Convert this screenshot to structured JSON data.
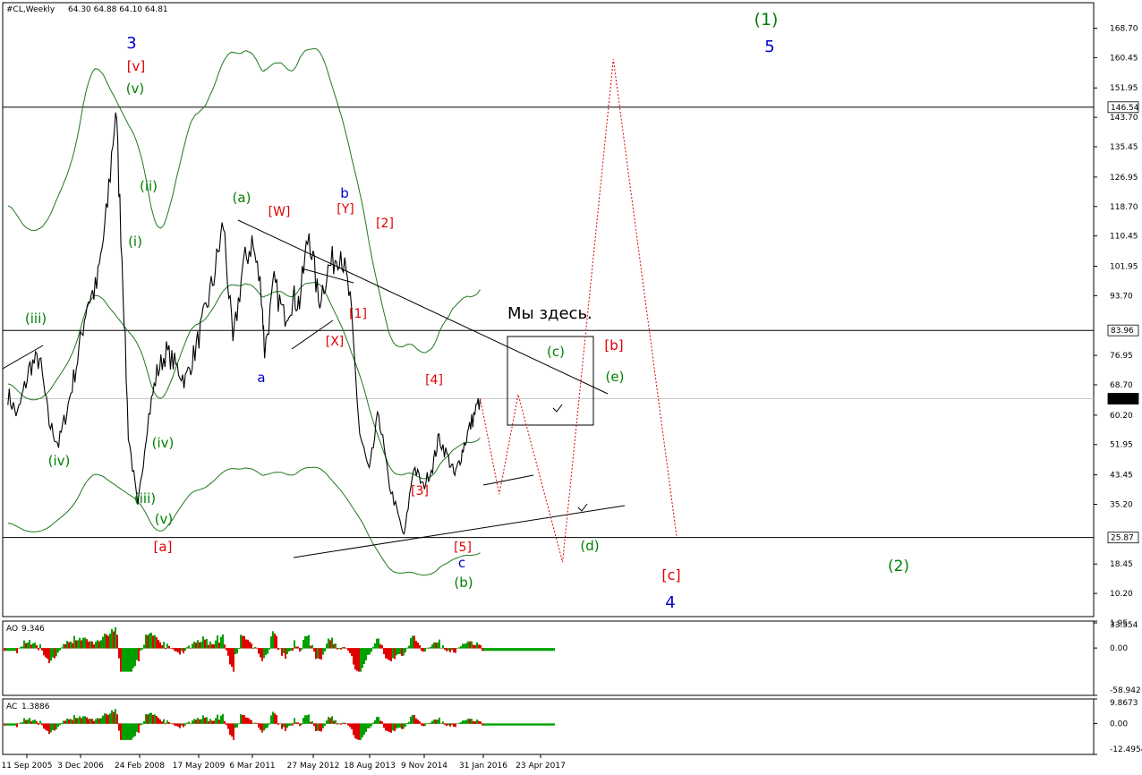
{
  "header": {
    "symbol": "#CL,Weekly",
    "ohlc": "64.30 64.88 64.10 64.81"
  },
  "chart_data": {
    "type": "line",
    "price_axis": {
      "ticks": [
        "168.70",
        "160.45",
        "151.95",
        "143.70",
        "135.45",
        "126.95",
        "118.70",
        "110.45",
        "101.95",
        "93.70",
        "76.95",
        "68.70",
        "60.20",
        "51.95",
        "43.45",
        "35.20",
        "18.45",
        "10.20",
        "1.95"
      ],
      "tick_values": [
        168.7,
        160.45,
        151.95,
        143.7,
        135.45,
        126.95,
        118.7,
        110.45,
        101.95,
        93.7,
        76.95,
        68.7,
        60.2,
        51.95,
        43.45,
        35.2,
        18.45,
        10.2,
        1.95
      ],
      "range": [
        1.95,
        168.7
      ]
    },
    "price_tags": [
      {
        "label": "146.54",
        "value": 146.54,
        "style": "line"
      },
      {
        "label": "83.96",
        "value": 83.96,
        "style": "line"
      },
      {
        "label": "64.81",
        "value": 64.81,
        "style": "current"
      },
      {
        "label": "25.87",
        "value": 25.87,
        "style": "line"
      }
    ],
    "time_axis": [
      "11 Sep 2005",
      "3 Dec 2006",
      "24 Feb 2008",
      "17 May 2009",
      "6 Mar 2011",
      "27 May 2012",
      "18 Aug 2013",
      "9 Nov 2014",
      "31 Jan 2016",
      "23 Apr 2017"
    ],
    "price_series": [
      [
        "2005-09",
        66
      ],
      [
        "2005-12",
        60
      ],
      [
        "2006-04",
        74
      ],
      [
        "2006-07",
        76
      ],
      [
        "2006-10",
        58
      ],
      [
        "2007-01",
        52
      ],
      [
        "2007-04",
        63
      ],
      [
        "2007-07",
        76
      ],
      [
        "2007-10",
        92
      ],
      [
        "2008-01",
        96
      ],
      [
        "2008-04",
        115
      ],
      [
        "2008-07",
        146.5
      ],
      [
        "2008-09",
        105
      ],
      [
        "2008-11",
        55
      ],
      [
        "2009-02",
        34
      ],
      [
        "2009-05",
        58
      ],
      [
        "2009-08",
        72
      ],
      [
        "2009-11",
        78
      ],
      [
        "2010-02",
        74
      ],
      [
        "2010-05",
        70
      ],
      [
        "2010-08",
        78
      ],
      [
        "2010-11",
        88
      ],
      [
        "2011-02",
        99
      ],
      [
        "2011-05",
        114
      ],
      [
        "2011-08",
        80
      ],
      [
        "2011-11",
        101
      ],
      [
        "2012-02",
        109
      ],
      [
        "2012-05",
        95
      ],
      [
        "2012-06",
        78
      ],
      [
        "2012-09",
        97
      ],
      [
        "2012-12",
        88
      ],
      [
        "2013-03",
        93
      ],
      [
        "2013-05",
        92
      ],
      [
        "2013-08",
        112
      ],
      [
        "2013-11",
        92
      ],
      [
        "2014-02",
        101
      ],
      [
        "2014-06",
        107
      ],
      [
        "2014-09",
        92
      ],
      [
        "2014-12",
        55
      ],
      [
        "2015-03",
        44
      ],
      [
        "2015-06",
        61
      ],
      [
        "2015-09",
        42
      ],
      [
        "2016-02",
        26
      ],
      [
        "2016-05",
        46
      ],
      [
        "2016-08",
        40
      ],
      [
        "2016-11",
        46
      ],
      [
        "2017-01",
        54
      ],
      [
        "2017-04",
        48
      ],
      [
        "2017-06",
        43
      ],
      [
        "2017-08",
        49
      ],
      [
        "2017-10",
        55
      ],
      [
        "2017-12",
        60
      ],
      [
        "2018-02",
        64.81
      ]
    ],
    "projection": [
      [
        "2018-02",
        64.81
      ],
      [
        "2018-08",
        38
      ],
      [
        "2019-02",
        66
      ],
      [
        "2020-04",
        19
      ],
      [
        "2021-08",
        160
      ],
      [
        "2023-04",
        26
      ]
    ],
    "wave_labels": [
      {
        "text": "3",
        "color": "#0000cc"
      },
      {
        "text": "[v]",
        "color": "#e00000"
      },
      {
        "text": "(v)",
        "color": "#008000"
      },
      {
        "text": "(ii)",
        "color": "#008000"
      },
      {
        "text": "(i)",
        "color": "#008000"
      },
      {
        "text": "(iii)",
        "color": "#008000"
      },
      {
        "text": "(iv)",
        "color": "#008000"
      },
      {
        "text": "(iv)",
        "color": "#008000"
      },
      {
        "text": "(iii)",
        "color": "#008000"
      },
      {
        "text": "(v)",
        "color": "#008000"
      },
      {
        "text": "[a]",
        "color": "#e00000"
      },
      {
        "text": "(a)",
        "color": "#008000"
      },
      {
        "text": "[W]",
        "color": "#e00000"
      },
      {
        "text": "a",
        "color": "#0000cc"
      },
      {
        "text": "[X]",
        "color": "#e00000"
      },
      {
        "text": "b",
        "color": "#0000cc"
      },
      {
        "text": "[Y]",
        "color": "#e00000"
      },
      {
        "text": "[2]",
        "color": "#e00000"
      },
      {
        "text": "[1]",
        "color": "#e00000"
      },
      {
        "text": "[4]",
        "color": "#e00000"
      },
      {
        "text": "[3]",
        "color": "#e00000"
      },
      {
        "text": "[5]",
        "color": "#e00000"
      },
      {
        "text": "c",
        "color": "#0000cc"
      },
      {
        "text": "(b)",
        "color": "#008000"
      },
      {
        "text": "(c)",
        "color": "#008000"
      },
      {
        "text": "[b]",
        "color": "#e00000"
      },
      {
        "text": "(e)",
        "color": "#008000"
      },
      {
        "text": "(d)",
        "color": "#008000"
      },
      {
        "text": "[c]",
        "color": "#e00000"
      },
      {
        "text": "4",
        "color": "#0000cc"
      },
      {
        "text": "(1)",
        "color": "#008000"
      },
      {
        "text": "5",
        "color": "#0000cc"
      },
      {
        "text": "(2)",
        "color": "#008000"
      }
    ],
    "annotation": "Мы здесь.",
    "indicators": [
      {
        "name": "AO",
        "value": "9.346",
        "ticks": [
          "33.554",
          "0.00",
          "-58.942"
        ],
        "range": [
          -58.942,
          33.554
        ]
      },
      {
        "name": "AC",
        "value": "1.3886",
        "ticks": [
          "9.8673",
          "0.00",
          "-12.4954"
        ],
        "range": [
          -12.4954,
          9.8673
        ]
      }
    ],
    "colors": {
      "up": "#00a000",
      "down": "#e00000",
      "price": "#000000",
      "bands": "#207820",
      "projection": "#e00000",
      "background": "#ffffff"
    }
  }
}
